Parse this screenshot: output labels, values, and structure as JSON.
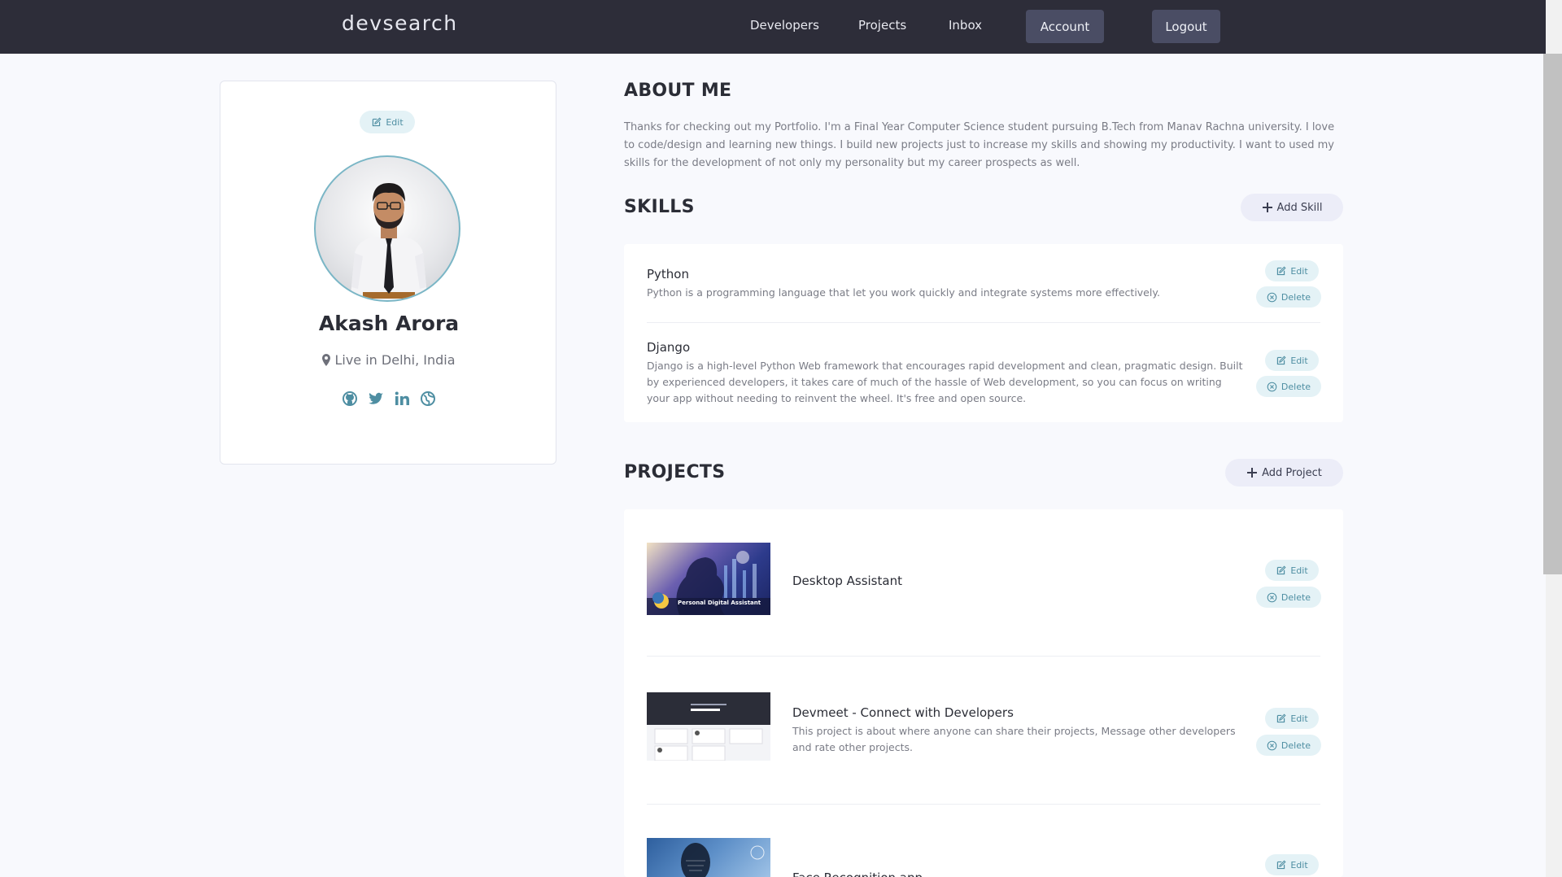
{
  "header": {
    "logo": "devsearch",
    "nav": [
      "Developers",
      "Projects",
      "Inbox"
    ],
    "account_label": "Account",
    "logout_label": "Logout"
  },
  "profile": {
    "edit_label": "Edit",
    "name": "Akash Arora",
    "location": "Live in Delhi, India",
    "socials": [
      "github-icon",
      "twitter-icon",
      "linkedin-icon",
      "website-icon"
    ]
  },
  "about": {
    "title": "ABOUT ME",
    "text": "Thanks for checking out my Portfolio. I'm a Final Year Computer Science student pursuing B.Tech from Manav Rachna university. I love to code/design and learning new things. I build new projects just to increase my skills and showing my productivity. I want to used my skills for the development of not only my personality but my career prospects as well."
  },
  "skills": {
    "title": "SKILLS",
    "add_label": "Add Skill",
    "items": [
      {
        "name": "Python",
        "description": "Python is a programming language that let you work quickly and integrate systems more effectively."
      },
      {
        "name": "Django",
        "description": "Django is a high-level Python Web framework that encourages rapid development and clean, pragmatic design. Built by experienced developers, it takes care of much of the hassle of Web development, so you can focus on writing your app without needing to reinvent the wheel. It's free and open source."
      }
    ]
  },
  "projects": {
    "title": "PROJECTS",
    "add_label": "Add Project",
    "items": [
      {
        "name": "Desktop Assistant",
        "description": "",
        "thumb_caption": "Personal Digital Assistant"
      },
      {
        "name": "Devmeet - Connect with Developers",
        "description": "This project is about where anyone can share their projects, Message other developers and rate other projects."
      },
      {
        "name": "Face Recognition app",
        "description": ""
      }
    ]
  },
  "actions": {
    "edit_label": "Edit",
    "delete_label": "Delete"
  },
  "colors": {
    "header_bg": "#2d2d39",
    "accent": "#4e8ea2",
    "page_bg": "#f8f9fd"
  }
}
